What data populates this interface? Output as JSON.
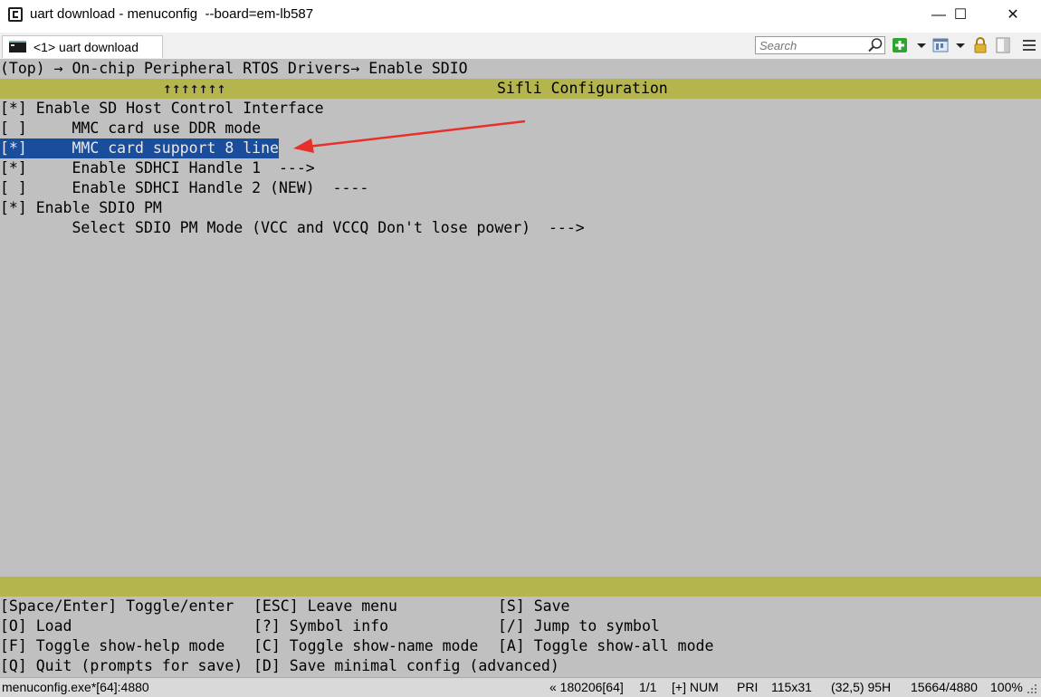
{
  "window": {
    "title": "uart download - menuconfig  --board=em-lb587",
    "minimize": "—",
    "maximize": "☐",
    "close": "✕"
  },
  "tab": {
    "label": "<1> uart download"
  },
  "search": {
    "placeholder": "Search"
  },
  "terminal": {
    "breadcrumb": "(Top) → On-chip Peripheral RTOS Drivers→ Enable SDIO",
    "scroll_arrows": "↑↑↑↑↑↑↑",
    "header": "Sifli Configuration",
    "menu_items": [
      {
        "text": "[*] Enable SD Host Control Interface"
      },
      {
        "text": "[ ]     MMC card use DDR mode"
      },
      {
        "text": "[*]     MMC card support 8 line",
        "selected": true
      },
      {
        "text": "[*]     Enable SDHCI Handle 1  --->"
      },
      {
        "text": "[ ]     Enable SDHCI Handle 2 (NEW)  ----"
      },
      {
        "text": "[*] Enable SDIO PM"
      },
      {
        "text": "        Select SDIO PM Mode (VCC and VCCQ Don't lose power)  --->"
      }
    ],
    "help": [
      [
        "[Space/Enter] Toggle/enter",
        "[ESC] Leave menu",
        "[S] Save"
      ],
      [
        "[O] Load",
        "[?] Symbol info",
        "[/] Jump to symbol"
      ],
      [
        "[F] Toggle show-help mode",
        "[C] Toggle show-name mode",
        "[A] Toggle show-all mode"
      ],
      [
        "[Q] Quit (prompts for save)",
        "[D] Save minimal config (advanced)",
        ""
      ]
    ]
  },
  "status": {
    "process": "menuconfig.exe*[64]:4880",
    "build": "« 180206[64]",
    "pos": "1/1",
    "flags": "[+] NUM",
    "pri": "PRI",
    "size": "115x31",
    "cursor": "(32,5) 95H",
    "pid": "15664/4880",
    "zoom": "100%"
  },
  "colors": {
    "terminal_bg": "#c0c0c0",
    "olive_bar": "#b5b54d",
    "selection": "#1a4d9c",
    "arrow": "#e8302a"
  }
}
